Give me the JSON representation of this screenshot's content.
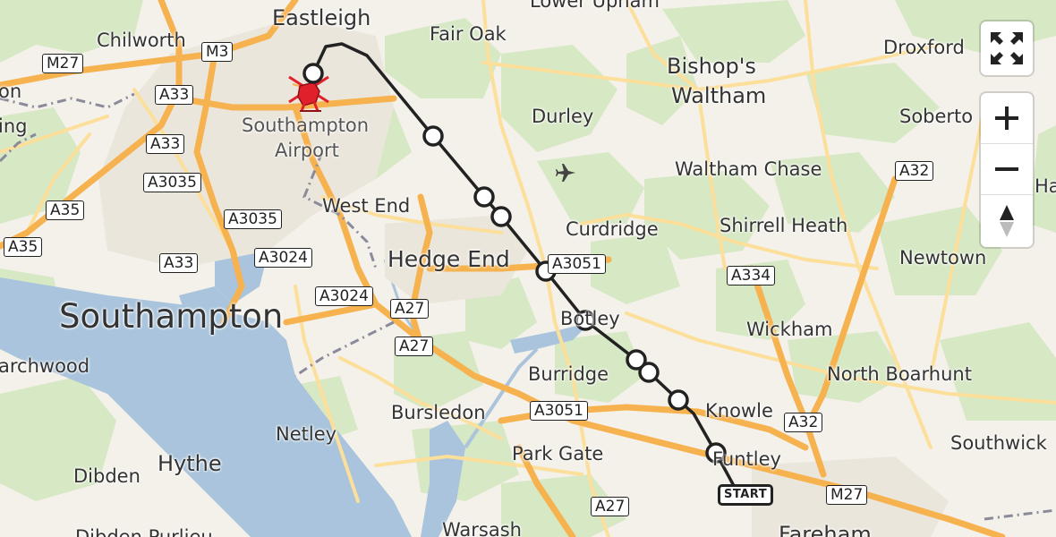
{
  "map": {
    "places": [
      {
        "id": "eastleigh",
        "name": "Eastleigh",
        "size": 24
      },
      {
        "id": "chilworth",
        "name": "Chilworth",
        "size": 21
      },
      {
        "id": "fair-oak",
        "name": "Fair Oak",
        "size": 21
      },
      {
        "id": "lower-upham",
        "name": "Lower Upham",
        "size": 21
      },
      {
        "id": "bishops-waltham-1",
        "name": "Bishop's",
        "size": 24
      },
      {
        "id": "bishops-waltham-2",
        "name": "Waltham",
        "size": 24
      },
      {
        "id": "droxford",
        "name": "Droxford",
        "size": 21
      },
      {
        "id": "soberton",
        "name": "Soberto",
        "size": 21
      },
      {
        "id": "durley",
        "name": "Durley",
        "size": 21
      },
      {
        "id": "waltham-chase",
        "name": "Waltham Chase",
        "size": 21
      },
      {
        "id": "southampton-airport-1",
        "name": "Southampton",
        "size": 21
      },
      {
        "id": "southampton-airport-2",
        "name": "Airport",
        "size": 21
      },
      {
        "id": "west-end",
        "name": "West End",
        "size": 21
      },
      {
        "id": "hedge-end",
        "name": "Hedge End",
        "size": 25
      },
      {
        "id": "curdridge",
        "name": "Curdridge",
        "size": 21
      },
      {
        "id": "shirrell-heath",
        "name": "Shirrell Heath",
        "size": 21
      },
      {
        "id": "newtown",
        "name": "Newtown",
        "size": 21
      },
      {
        "id": "southampton",
        "name": "Southampton",
        "size": 37
      },
      {
        "id": "botley",
        "name": "Botley",
        "size": 21
      },
      {
        "id": "wickham",
        "name": "Wickham",
        "size": 21
      },
      {
        "id": "marchwood",
        "name": "archwood",
        "size": 21
      },
      {
        "id": "burridge",
        "name": "Burridge",
        "size": 21
      },
      {
        "id": "north-boarhunt",
        "name": "North Boarhunt",
        "size": 21
      },
      {
        "id": "knowle",
        "name": "Knowle",
        "size": 21
      },
      {
        "id": "bursledon",
        "name": "Bursledon",
        "size": 21
      },
      {
        "id": "netley",
        "name": "Netley",
        "size": 21
      },
      {
        "id": "hythe",
        "name": "Hythe",
        "size": 24
      },
      {
        "id": "dibden",
        "name": "Dibden",
        "size": 21
      },
      {
        "id": "park-gate",
        "name": "Park Gate",
        "size": 21
      },
      {
        "id": "funtley",
        "name": "Funtley",
        "size": 21
      },
      {
        "id": "southwick",
        "name": "Southwick",
        "size": 21
      },
      {
        "id": "warsash",
        "name": "Warsash",
        "size": 21
      },
      {
        "id": "dibden-purlieu",
        "name": "Dibden Purlieu",
        "size": 21
      },
      {
        "id": "fareham",
        "name": "Fareham",
        "size": 24
      },
      {
        "id": "nursling",
        "name": "on",
        "size": 21
      },
      {
        "id": "rownhams",
        "name": "ing",
        "size": 21
      },
      {
        "id": "hambledon",
        "name": "Ha",
        "size": 21
      }
    ],
    "roads": [
      {
        "id": "m27-west",
        "label": "M27"
      },
      {
        "id": "m3",
        "label": "M3"
      },
      {
        "id": "a33-north",
        "label": "A33"
      },
      {
        "id": "a33-mid",
        "label": "A33"
      },
      {
        "id": "a3035-a",
        "label": "A3035"
      },
      {
        "id": "a35-a",
        "label": "A35"
      },
      {
        "id": "a3035-b",
        "label": "A3035"
      },
      {
        "id": "a35-b",
        "label": "A35"
      },
      {
        "id": "a33-south",
        "label": "A33"
      },
      {
        "id": "a3024-a",
        "label": "A3024"
      },
      {
        "id": "a3024-b",
        "label": "A3024"
      },
      {
        "id": "a27-a",
        "label": "A27"
      },
      {
        "id": "a27-b",
        "label": "A27"
      },
      {
        "id": "a3051-a",
        "label": "A3051"
      },
      {
        "id": "a334",
        "label": "A334"
      },
      {
        "id": "a32-north",
        "label": "A32"
      },
      {
        "id": "a3051-b",
        "label": "A3051"
      },
      {
        "id": "a32-south",
        "label": "A32"
      },
      {
        "id": "m27-east",
        "label": "M27"
      },
      {
        "id": "a27-c",
        "label": "A27"
      }
    ],
    "route": {
      "start_label": "START",
      "waypoint_count": 10,
      "line_color": "#222222",
      "destination_icon": "helicopter-icon",
      "destination_color": "#e0202a"
    },
    "colors": {
      "land": "#f4f1ea",
      "woodland": "#d6e8c4",
      "water": "#a9c4dc",
      "major_road": "#f6b24e",
      "minor_road": "#fcdf9a"
    }
  },
  "controls": {
    "fullscreen_icon": "fullscreen-icon",
    "zoom_in_icon": "plus-icon",
    "zoom_out_icon": "minus-icon",
    "compass_icon": "compass-icon",
    "airport_icon": "airplane-icon"
  }
}
